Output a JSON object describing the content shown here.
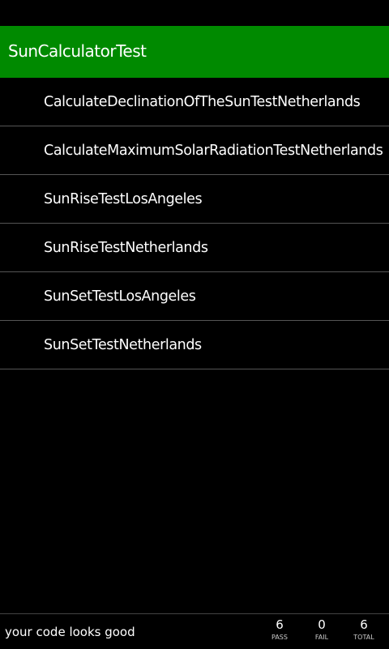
{
  "header": {
    "title": "SunCalculatorTest"
  },
  "tests": [
    "CalculateDeclinationOfTheSunTestNetherlands",
    "CalculateMaximumSolarRadiationTestNetherlands",
    "SunRiseTestLosAngeles",
    "SunRiseTestNetherlands",
    "SunSetTestLosAngeles",
    "SunSetTestNetherlands"
  ],
  "footer": {
    "status": "your code looks good",
    "pass": {
      "value": "6",
      "label": "PASS"
    },
    "fail": {
      "value": "0",
      "label": "FAIL"
    },
    "total": {
      "value": "6",
      "label": "TOTAL"
    }
  },
  "colors": {
    "accent": "#008a00"
  }
}
